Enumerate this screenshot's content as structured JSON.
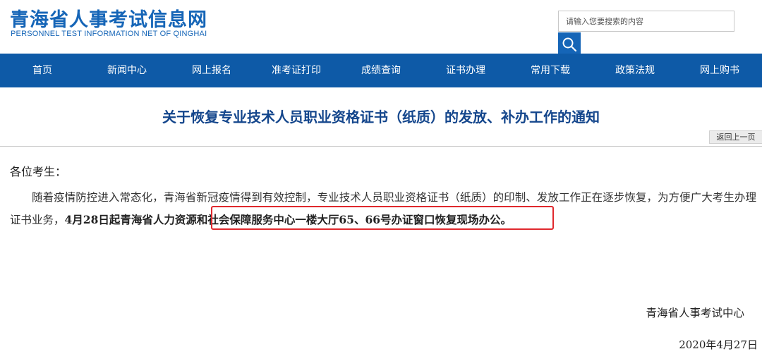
{
  "header": {
    "site_title": "青海省人事考试信息网",
    "site_subtitle": "PERSONNEL TEST INFORMATION NET OF QINGHAI",
    "search": {
      "placeholder": "请输入您要搜索的内容",
      "value": "",
      "icon": "search-icon"
    }
  },
  "nav": {
    "items": [
      {
        "label": "首页"
      },
      {
        "label": "新闻中心"
      },
      {
        "label": "网上报名"
      },
      {
        "label": "准考证打印"
      },
      {
        "label": "成绩查询"
      },
      {
        "label": "证书办理"
      },
      {
        "label": "常用下载"
      },
      {
        "label": "政策法规"
      },
      {
        "label": "网上购书"
      }
    ]
  },
  "article": {
    "title": "关于恢复专业技术人员职业资格证书（纸质）的发放、补办工作的通知",
    "back_label": "返回上一页",
    "salutation": "各位考生：",
    "body_normal": "随着疫情防控进入常态化，青海省新冠疫情得到有效控制，专业技术人员职业资格证书（纸质）的印制、发放工作正在逐步恢复，为方便广大考生办理证书业务，",
    "body_highlight": "4月28日起青海省人力资源和社会保障服务中心一楼大厅",
    "body_bold_tail": "65、66号办证窗口恢复现场办公。",
    "signature": "青海省人事考试中心",
    "date": "2020年4月27日"
  },
  "colors": {
    "brand_blue": "#1565b7",
    "nav_blue": "#0e5aa7",
    "title_blue": "#14468c",
    "highlight_red": "#e0282d"
  }
}
